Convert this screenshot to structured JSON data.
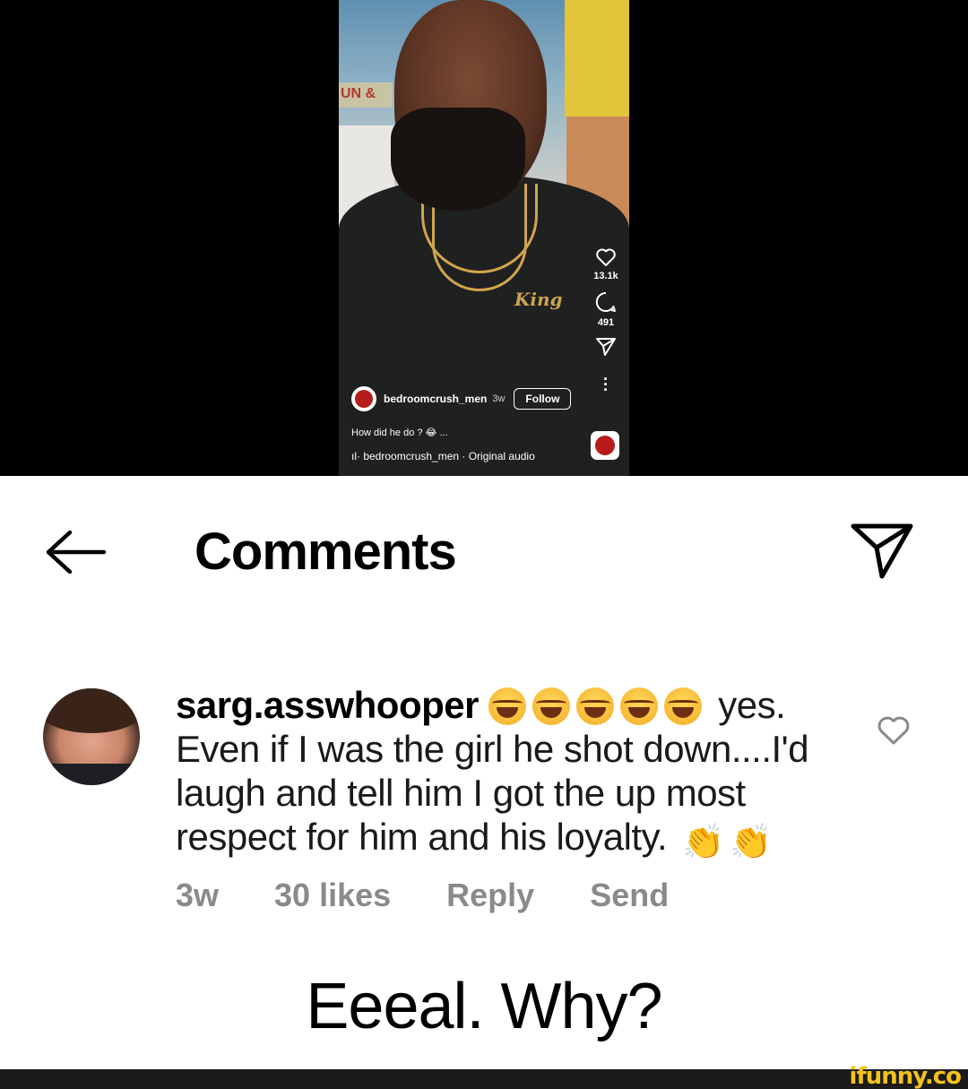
{
  "video": {
    "poster_username": "bedroomcrush_men",
    "poster_time": "3w",
    "follow_label": "Follow",
    "caption": "How did he do ? 😂 ...",
    "audio": "ıl· bedroomcrush_men · Original audio",
    "likes_count": "13.1k",
    "comments_count": "491",
    "background_sign": "UN &",
    "shirt_logo": "King"
  },
  "header": {
    "title": "Comments"
  },
  "comment": {
    "username": "sarg.asswhooper",
    "text_after_emojis": " yes. Even if I was the girl he shot down....I'd laugh and tell him I got the up most respect for him and his loyalty. ",
    "laugh_emoji_count": 5,
    "clap_emoji": "👏",
    "time": "3w",
    "likes": "30 likes",
    "reply_label": "Reply",
    "send_label": "Send"
  },
  "bottom_caption": "Eeeal. Why?",
  "watermark": "ifunny.co",
  "icons": [
    "back-arrow-icon",
    "share-icon",
    "heart-icon",
    "comment-icon",
    "send-icon",
    "more-icon"
  ]
}
